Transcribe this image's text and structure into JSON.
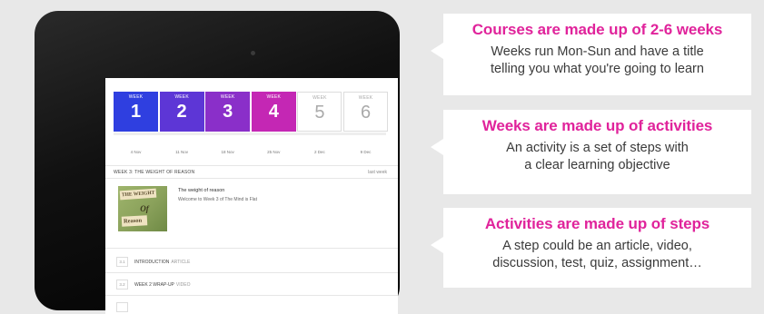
{
  "tablet": {
    "weeks": [
      {
        "label": "WEEK",
        "number": "1",
        "color": "#2f3fe0",
        "date": "4 Nov",
        "active": true
      },
      {
        "label": "WEEK",
        "number": "2",
        "color": "#5d36d6",
        "date": "11 Nov",
        "active": true
      },
      {
        "label": "WEEK",
        "number": "3",
        "color": "#8a2fc9",
        "date": "18 Nov",
        "active": true
      },
      {
        "label": "WEEK",
        "number": "4",
        "color": "#c427b4",
        "date": "25 Nov",
        "active": true
      },
      {
        "label": "WEEK",
        "number": "5",
        "color": "#ffffff",
        "date": "2 Dec",
        "active": false
      },
      {
        "label": "WEEK",
        "number": "6",
        "color": "#ffffff",
        "date": "9 Dec",
        "active": false
      }
    ],
    "section_title": "WEEK 3: THE WEIGHT OF REASON",
    "last_week_link": "last week",
    "activity": {
      "title": "The weight of reason",
      "description": "Welcome to Week 3 of The Mind is Flat",
      "thumbnail": {
        "line1": "THE WEIGHT",
        "line2": "Of",
        "line3": "Reason"
      }
    },
    "steps": [
      {
        "number": "3.1",
        "title": "INTRODUCTION",
        "type": "ARTICLE"
      },
      {
        "number": "3.2",
        "title": "WEEK 2 WRAP-UP",
        "type": "VIDEO"
      }
    ]
  },
  "callouts": [
    {
      "title": "Courses are made up of 2-6 weeks",
      "body_lines": [
        "Weeks run Mon-Sun and have a title",
        "telling you what you're going to learn"
      ]
    },
    {
      "title": "Weeks are made up of activities",
      "body_lines": [
        "An activity is a set of steps with",
        "a clear learning objective"
      ]
    },
    {
      "title": "Activities are made up of steps",
      "body_lines": [
        "A step could be an article, video,",
        "discussion, test, quiz, assignment…"
      ]
    }
  ],
  "colors": {
    "accent": "#e0239b",
    "marker": "#e21da2"
  }
}
